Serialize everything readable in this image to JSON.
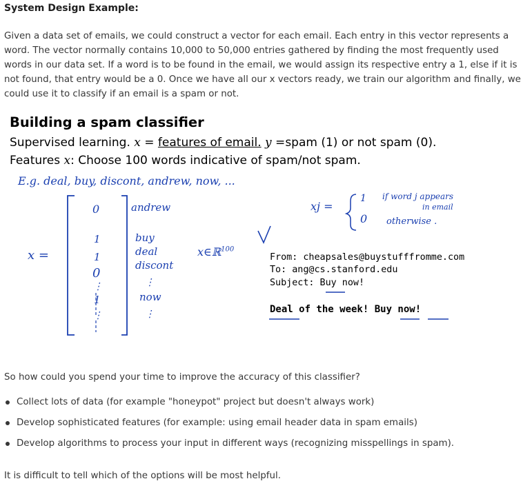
{
  "section_heading": "System Design Example:",
  "intro_paragraph": "Given a data set of emails, we could construct a vector for each email. Each entry in this vector represents a word. The vector normally contains 10,000 to 50,000 entries gathered by finding the most frequently used words in our data set. If a word is to be found in the email, we would assign its respective entry a 1, else if it is not found, that entry would be a 0. Once we have all our x vectors ready, we train our algorithm and finally, we could use it to classify if an email is a spam or not.",
  "slide": {
    "title": "Building a spam classifier",
    "line1_prefix": "Supervised learning.",
    "line1_x": "x",
    "line1_eq1": " = ",
    "line1_features": "features of email.",
    "line1_y": "y",
    "line1_eq2": " =",
    "line1_suffix": "spam (1) or not spam (0).",
    "line2_prefix": "Features ",
    "line2_x": "x",
    "line2_suffix": ": Choose 100 words indicative of spam/not spam.",
    "handwritten_example": "E.g. deal, buy, discont, andrew, now, ...",
    "vector_label": "x =",
    "vector_values": [
      "0",
      "1",
      "1",
      "0",
      "⋮",
      "1",
      "⋮"
    ],
    "vector_words": [
      "andrew",
      "buy",
      "deal",
      "discont",
      "⋮",
      "now",
      "⋮"
    ],
    "dimension": "x∈ℝ",
    "dimension_exp": "100",
    "xj_def": "xj =",
    "case1_value": "1",
    "case1_text": "if word j appears",
    "case1_text2": "in email",
    "case0_value": "0",
    "case0_text": "otherwise .",
    "email": {
      "from": "From: cheapsales@buystufffromme.com",
      "to": "To: ang@cs.stanford.edu",
      "subject": "Subject: Buy now!",
      "body": "Deal of the week! Buy now!"
    }
  },
  "question": "So how could you spend your time to improve the accuracy of this classifier?",
  "bullets": [
    "Collect lots of data (for example \"honeypot\" project but doesn't always work)",
    "Develop sophisticated features (for example: using email header data in spam emails)",
    "Develop algorithms to process your input in different ways (recognizing misspellings in spam)."
  ],
  "closing": "It is difficult to tell which of the options will be most helpful.",
  "colors": {
    "ink": "#1a3fb0",
    "text": "#373737",
    "heading": "#1f1f1f"
  }
}
